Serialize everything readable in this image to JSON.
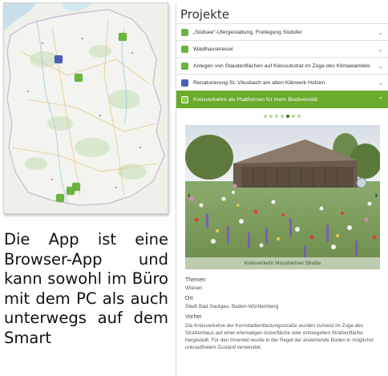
{
  "description": "Die App ist eine Browser-App und kann sowohl im Büro mit dem PC als auch unterwegs auf dem Smart",
  "panel": {
    "title": "Projekte",
    "items": [
      {
        "label": "„Südsee“-Ufergestaltung, Freilegung Südufer",
        "icon": "green-square-icon",
        "color": "#6db33f",
        "active": false
      },
      {
        "label": "Waldhauskreisel",
        "icon": "green-square-icon",
        "color": "#6db33f",
        "active": false
      },
      {
        "label": "Anlegen von Staudenflächen auf Kiessubstrat im Zuge des Klimawandels",
        "icon": "green-square-icon",
        "color": "#6db33f",
        "active": false
      },
      {
        "label": "Renaturierung St. Vitusbach am alten Klärwerk Holzen",
        "icon": "blue-square-icon",
        "color": "#4a5fb8",
        "active": false
      },
      {
        "label": "Kreisverkehre als Plattformen für mehr Biodiversität",
        "icon": "green-square-icon",
        "color": "#6aaa2d",
        "active": true
      }
    ],
    "carousel": {
      "count": 7,
      "current": 4
    },
    "photo_caption": "Kreisverkehr Mooshelmer Straße",
    "details": {
      "themen_label": "Themen",
      "themen_value": "Wiesen",
      "ort_label": "Ort",
      "ort_value": "Stadt Bad Saulgau, Baden-Württemberg",
      "vorher_label": "Vorher",
      "vorher_text": "Die Kreisverkehre der Kernstadtentlastungsstraße wurden zumeist im Zuge des Straßenbaus auf einer ehemaligen Ackerfläche oder entsiegelten Straßenfläche hergestellt. Für den Innenteil wurde in der Regel der anstehende Boden in möglichst unkrautfreiem Zustand verwendet."
    }
  },
  "colors": {
    "accent": "#6aaa2d",
    "marker_green": "#6db33f",
    "marker_blue": "#4a5fb8"
  }
}
